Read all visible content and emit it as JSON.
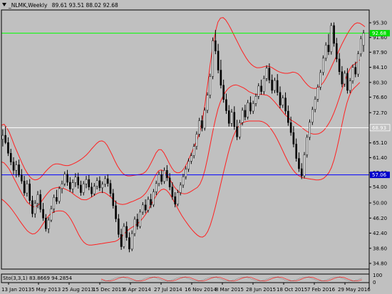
{
  "header": {
    "symbol": "_NLMK,Weekly",
    "ohlc": "89.61 93.51 88.02 92.68"
  },
  "indicator": {
    "label": "Sto(3,3,1) 83.8669 94.2854"
  },
  "colors": {
    "background": "#c0c0c0",
    "bull_body": "#ffffff",
    "bear_body": "#000000",
    "wick": "#000000",
    "bands": "#ff2020",
    "line_green": "#00ff00",
    "line_white": "#ffffff",
    "line_blue": "#0000ff",
    "price_tag_bg": "#00dd00",
    "blue_tag_bg": "#0000cc"
  },
  "chart_data": {
    "type": "candlestick",
    "y_axis_labels": [
      "95.30",
      "91.60",
      "87.90",
      "84.10",
      "80.30",
      "76.60",
      "72.70",
      "69.00",
      "65.10",
      "61.40",
      "57.60",
      "54.00",
      "50.00",
      "46.20",
      "42.40",
      "38.60",
      "34.80"
    ],
    "ylim": [
      34.8,
      95.3
    ],
    "x_axis_labels": [
      "13 Jan 2013",
      "5 May 2013",
      "25 Aug 2013",
      "15 Dec 2013",
      "6 Apr 2014",
      "27 Jul 2014",
      "16 Nov 2014",
      "8 Mar 2015",
      "28 Jun 2015",
      "18 Oct 2015",
      "7 Feb 2016",
      "29 May 2016"
    ],
    "price_tags": [
      {
        "label": "92.68",
        "value": 92.68,
        "role": "current"
      },
      {
        "label": "68.93",
        "value": 68.93,
        "role": "white-line"
      },
      {
        "label": "57.06",
        "value": 57.06,
        "role": "blue-line"
      }
    ],
    "horizontal_lines": [
      {
        "value": 92.68,
        "color": "#00ff00"
      },
      {
        "value": 68.93,
        "color": "#ffffff"
      },
      {
        "value": 57.06,
        "color": "#0000ff"
      }
    ],
    "bands": {
      "upper": [
        69.5,
        69.8,
        69.0,
        67.8,
        66.2,
        64.5,
        63.0,
        61.5,
        60.0,
        58.6,
        57.5,
        56.6,
        56.0,
        55.8,
        55.9,
        56.3,
        57.0,
        57.8,
        58.5,
        59.1,
        59.6,
        59.8,
        59.8,
        59.7,
        59.5,
        59.4,
        59.4,
        59.6,
        59.9,
        60.2,
        60.6,
        61.0,
        61.5,
        62.1,
        62.8,
        63.6,
        64.3,
        65.0,
        65.5,
        65.6,
        65.3,
        64.5,
        63.3,
        62.0,
        60.6,
        59.3,
        58.3,
        57.5,
        57.0,
        56.8,
        56.8,
        56.9,
        57.0,
        57.1,
        57.2,
        57.4,
        57.9,
        58.8,
        60.0,
        61.3,
        62.6,
        63.4,
        63.4,
        62.6,
        61.4,
        60.1,
        58.9,
        58.0,
        57.6,
        57.6,
        58.0,
        58.8,
        60.0,
        61.5,
        63.0,
        64.5,
        66.0,
        68.0,
        71.0,
        75.0,
        80.0,
        85.0,
        89.5,
        93.0,
        95.5,
        96.5,
        96.6,
        96.0,
        95.0,
        93.8,
        92.5,
        91.2,
        89.9,
        88.6,
        87.5,
        86.4,
        85.5,
        84.8,
        84.3,
        84.0,
        84.0,
        84.1,
        84.3,
        84.4,
        84.3,
        84.0,
        83.6,
        83.2,
        82.9,
        82.7,
        82.6,
        82.6,
        82.7,
        82.9,
        82.8,
        82.5,
        81.9,
        81.0,
        80.2,
        79.5,
        79.0,
        78.8,
        78.8,
        79.1,
        79.6,
        80.4,
        81.5,
        82.8,
        84.2,
        85.6,
        87.0,
        88.4,
        89.8,
        91.1,
        92.3,
        93.4,
        94.3,
        95.0,
        95.3,
        95.2,
        94.8,
        94.3
      ],
      "lower": [
        51.0,
        50.5,
        49.9,
        49.2,
        48.4,
        47.5,
        46.6,
        45.6,
        44.7,
        43.8,
        43.0,
        42.5,
        42.2,
        42.3,
        42.8,
        43.6,
        44.6,
        45.6,
        46.5,
        47.2,
        47.6,
        47.9,
        48.0,
        48.0,
        47.9,
        47.5,
        46.8,
        45.8,
        44.6,
        43.3,
        42.0,
        40.9,
        40.1,
        39.6,
        39.4,
        39.4,
        39.5,
        39.6,
        39.7,
        39.8,
        39.9,
        40.0,
        40.1,
        40.2,
        40.3,
        40.6,
        41.1,
        41.8,
        42.5,
        43.1,
        43.6,
        44.0,
        44.4,
        44.9,
        45.5,
        46.3,
        47.2,
        48.3,
        49.5,
        50.7,
        51.8,
        52.7,
        53.3,
        53.5,
        53.2,
        52.5,
        51.5,
        50.3,
        49.1,
        47.9,
        46.8,
        45.8,
        44.9,
        44.0,
        43.2,
        42.5,
        41.9,
        41.5,
        41.4,
        41.8,
        42.8,
        44.4,
        46.5,
        49.0,
        51.7,
        54.5,
        57.3,
        60.0,
        62.6,
        64.9,
        66.8,
        68.2,
        69.2,
        69.9,
        70.3,
        70.5,
        70.6,
        70.6,
        70.6,
        70.6,
        70.6,
        70.5,
        70.2,
        69.8,
        69.1,
        68.2,
        67.2,
        66.0,
        64.7,
        63.3,
        61.9,
        60.6,
        59.4,
        58.4,
        57.6,
        57.0,
        56.6,
        56.3,
        56.2,
        56.1,
        56.0,
        55.9,
        55.8,
        55.8,
        55.9,
        56.2,
        56.8,
        57.6,
        58.9,
        60.8,
        63.3,
        66.2,
        69.4,
        72.5,
        75.1,
        77.0,
        78.3,
        79.0,
        79.6,
        80.3
      ],
      "middle": [
        60.3,
        60.1,
        59.4,
        58.5,
        57.3,
        56.0,
        54.8,
        53.5,
        52.3,
        51.2,
        50.2,
        49.6,
        49.1,
        49.0,
        49.3,
        49.9,
        50.8,
        51.7,
        52.5,
        53.2,
        53.6,
        53.8,
        53.9,
        53.8,
        53.7,
        53.4,
        53.1,
        52.7,
        52.2,
        51.7,
        51.3,
        50.9,
        50.8,
        50.8,
        51.1,
        51.5,
        51.9,
        52.3,
        52.6,
        52.7,
        52.6,
        52.2,
        51.7,
        51.1,
        50.4,
        49.9,
        49.7,
        49.6,
        49.7,
        49.9,
        50.2,
        50.4,
        50.7,
        51.0,
        51.3,
        51.8,
        52.5,
        53.5,
        54.7,
        56.0,
        57.2,
        58.1,
        58.3,
        58.0,
        57.3,
        56.3,
        55.2,
        54.1,
        53.3,
        52.7,
        52.4,
        52.3,
        52.4,
        52.7,
        53.1,
        53.5,
        53.9,
        54.7,
        56.2,
        58.4,
        61.4,
        64.7,
        68.0,
        71.0,
        73.6,
        75.5,
        76.9,
        78.0,
        78.8,
        79.3,
        79.6,
        79.7,
        79.5,
        79.2,
        78.9,
        78.5,
        78.0,
        77.7,
        77.4,
        77.3,
        77.3,
        77.3,
        77.2,
        77.1,
        76.7,
        76.1,
        75.4,
        74.6,
        73.8,
        73.0,
        72.2,
        71.6,
        71.0,
        70.6,
        70.2,
        69.7,
        69.3,
        68.7,
        68.2,
        67.8,
        67.5,
        67.3,
        67.3,
        67.4,
        67.7,
        68.2,
        69.0,
        70.0,
        71.2,
        72.7,
        74.4,
        76.3,
        78.3,
        80.3,
        82.1,
        83.5,
        84.5,
        84.9,
        85.4,
        86.0
      ],
      "period_offset": 0
    },
    "candles": [
      [
        66.0,
        68.5,
        64.2,
        67.0
      ],
      [
        67.0,
        69.2,
        64.8,
        65.2
      ],
      [
        65.2,
        66.5,
        61.8,
        62.5
      ],
      [
        62.5,
        63.6,
        59.5,
        60.3
      ],
      [
        60.3,
        61.5,
        57.2,
        58.2
      ],
      [
        58.2,
        60.6,
        56.4,
        59.6
      ],
      [
        59.6,
        60.9,
        56.5,
        57.0
      ],
      [
        57.0,
        58.5,
        54.8,
        55.5
      ],
      [
        55.5,
        56.8,
        51.8,
        52.5
      ],
      [
        52.5,
        55.7,
        51.6,
        54.8
      ],
      [
        54.8,
        56.0,
        49.8,
        50.6
      ],
      [
        50.6,
        51.8,
        46.4,
        47.3
      ],
      [
        47.3,
        50.7,
        46.3,
        49.9
      ],
      [
        49.9,
        53.0,
        48.7,
        52.1
      ],
      [
        52.1,
        53.3,
        47.6,
        48.4
      ],
      [
        48.4,
        50.0,
        45.5,
        46.2
      ],
      [
        46.2,
        47.2,
        42.8,
        43.5
      ],
      [
        43.5,
        46.4,
        42.4,
        45.7
      ],
      [
        45.7,
        49.3,
        45.2,
        48.5
      ],
      [
        48.5,
        52.1,
        47.5,
        51.4
      ],
      [
        51.4,
        53.3,
        49.7,
        50.4
      ],
      [
        50.4,
        54.2,
        49.8,
        53.6
      ],
      [
        53.6,
        55.6,
        52.4,
        54.8
      ],
      [
        54.8,
        57.9,
        54.2,
        57.2
      ],
      [
        57.2,
        58.3,
        54.3,
        55.2
      ],
      [
        55.2,
        56.5,
        52.8,
        53.5
      ],
      [
        53.5,
        55.9,
        52.5,
        55.1
      ],
      [
        55.1,
        57.5,
        54.0,
        56.5
      ],
      [
        56.5,
        57.6,
        53.6,
        54.5
      ],
      [
        54.5,
        55.6,
        51.8,
        52.6
      ],
      [
        52.6,
        55.5,
        51.9,
        54.8
      ],
      [
        54.8,
        56.8,
        53.7,
        55.9
      ],
      [
        55.9,
        57.0,
        53.2,
        54.0
      ],
      [
        54.0,
        55.1,
        51.5,
        52.3
      ],
      [
        52.3,
        55.0,
        51.8,
        54.2
      ],
      [
        54.2,
        56.4,
        53.4,
        55.6
      ],
      [
        55.6,
        56.7,
        53.0,
        53.8
      ],
      [
        53.8,
        55.4,
        52.5,
        54.7
      ],
      [
        54.7,
        56.8,
        54.0,
        56.1
      ],
      [
        56.1,
        57.2,
        54.1,
        54.9
      ],
      [
        54.9,
        55.8,
        51.6,
        52.4
      ],
      [
        52.4,
        53.5,
        48.6,
        49.3
      ],
      [
        49.3,
        50.6,
        45.2,
        46.0
      ],
      [
        46.0,
        47.2,
        41.3,
        42.1
      ],
      [
        42.1,
        43.5,
        38.2,
        39.0
      ],
      [
        39.0,
        44.9,
        38.5,
        44.1
      ],
      [
        44.1,
        45.3,
        40.5,
        41.3
      ],
      [
        41.3,
        42.6,
        37.6,
        38.4
      ],
      [
        38.4,
        43.1,
        37.9,
        42.3
      ],
      [
        42.3,
        46.6,
        41.6,
        45.9
      ],
      [
        45.9,
        47.3,
        43.3,
        44.1
      ],
      [
        44.1,
        48.4,
        43.6,
        47.7
      ],
      [
        47.7,
        50.2,
        47.0,
        49.5
      ],
      [
        49.5,
        50.9,
        47.4,
        48.2
      ],
      [
        48.2,
        51.6,
        47.6,
        50.9
      ],
      [
        50.9,
        52.3,
        48.7,
        49.5
      ],
      [
        49.5,
        53.5,
        49.0,
        52.8
      ],
      [
        52.8,
        55.6,
        52.0,
        54.9
      ],
      [
        54.9,
        57.9,
        54.2,
        57.1
      ],
      [
        57.1,
        58.2,
        54.6,
        55.4
      ],
      [
        55.4,
        58.9,
        54.8,
        58.2
      ],
      [
        58.2,
        59.5,
        55.5,
        56.3
      ],
      [
        56.3,
        57.5,
        53.2,
        54.0
      ],
      [
        54.0,
        55.2,
        50.8,
        51.6
      ],
      [
        51.6,
        52.7,
        48.9,
        49.7
      ],
      [
        49.7,
        53.3,
        49.2,
        52.6
      ],
      [
        52.6,
        55.2,
        51.9,
        54.5
      ],
      [
        54.5,
        57.3,
        53.8,
        56.6
      ],
      [
        56.6,
        59.2,
        55.9,
        58.5
      ],
      [
        58.5,
        61.2,
        57.8,
        60.5
      ],
      [
        60.5,
        62.6,
        59.8,
        61.9
      ],
      [
        61.9,
        64.9,
        61.2,
        64.2
      ],
      [
        64.2,
        68.0,
        63.4,
        67.3
      ],
      [
        67.3,
        71.4,
        66.6,
        70.7
      ],
      [
        70.7,
        72.0,
        68.0,
        68.8
      ],
      [
        68.8,
        74.0,
        68.2,
        73.3
      ],
      [
        73.3,
        77.8,
        72.6,
        77.1
      ],
      [
        77.1,
        82.5,
        76.3,
        81.8
      ],
      [
        81.8,
        91.6,
        81.1,
        90.8
      ],
      [
        90.8,
        93.5,
        87.4,
        88.2
      ],
      [
        88.2,
        90.0,
        82.6,
        83.4
      ],
      [
        83.4,
        86.0,
        78.8,
        79.6
      ],
      [
        79.6,
        81.0,
        75.2,
        76.0
      ],
      [
        76.0,
        77.5,
        72.4,
        73.2
      ],
      [
        73.2,
        74.6,
        69.2,
        70.0
      ],
      [
        70.0,
        73.6,
        69.2,
        72.8
      ],
      [
        72.8,
        74.3,
        68.4,
        69.2
      ],
      [
        69.2,
        70.9,
        65.8,
        66.6
      ],
      [
        66.6,
        70.9,
        66.0,
        70.2
      ],
      [
        70.2,
        74.0,
        69.5,
        73.3
      ],
      [
        73.3,
        74.7,
        70.8,
        71.6
      ],
      [
        71.6,
        75.9,
        71.0,
        75.2
      ],
      [
        75.2,
        76.8,
        72.3,
        73.1
      ],
      [
        73.1,
        75.7,
        72.4,
        75.0
      ],
      [
        75.0,
        77.5,
        74.3,
        76.8
      ],
      [
        76.8,
        80.1,
        76.1,
        79.4
      ],
      [
        79.4,
        81.0,
        77.2,
        78.0
      ],
      [
        78.0,
        82.0,
        77.3,
        81.3
      ],
      [
        81.3,
        84.6,
        80.6,
        83.9
      ],
      [
        83.9,
        85.1,
        80.1,
        80.9
      ],
      [
        80.9,
        82.3,
        77.5,
        78.3
      ],
      [
        78.3,
        81.5,
        77.6,
        80.8
      ],
      [
        80.8,
        82.4,
        77.0,
        77.8
      ],
      [
        77.8,
        79.3,
        73.8,
        74.6
      ],
      [
        74.6,
        77.1,
        73.9,
        76.4
      ],
      [
        76.4,
        77.8,
        72.3,
        73.1
      ],
      [
        73.1,
        74.5,
        69.4,
        70.2
      ],
      [
        70.2,
        71.7,
        66.9,
        67.7
      ],
      [
        67.7,
        69.3,
        64.0,
        64.8
      ],
      [
        64.8,
        66.2,
        60.4,
        61.2
      ],
      [
        61.2,
        62.7,
        57.8,
        58.6
      ],
      [
        58.6,
        60.0,
        56.0,
        56.8
      ],
      [
        56.8,
        62.8,
        56.2,
        62.1
      ],
      [
        62.1,
        67.2,
        61.4,
        66.5
      ],
      [
        66.5,
        71.0,
        65.8,
        70.3
      ],
      [
        70.3,
        74.2,
        69.6,
        73.5
      ],
      [
        73.5,
        76.8,
        72.8,
        76.1
      ],
      [
        76.1,
        79.8,
        75.4,
        79.1
      ],
      [
        79.1,
        83.5,
        78.4,
        82.8
      ],
      [
        82.8,
        87.1,
        82.1,
        86.4
      ],
      [
        86.4,
        90.4,
        85.7,
        89.7
      ],
      [
        89.7,
        92.5,
        87.2,
        88.0
      ],
      [
        88.0,
        95.3,
        87.3,
        94.6
      ],
      [
        94.6,
        95.4,
        89.3,
        90.1
      ],
      [
        90.1,
        91.5,
        85.4,
        86.2
      ],
      [
        86.2,
        87.7,
        82.2,
        83.0
      ],
      [
        83.0,
        84.4,
        79.1,
        79.9
      ],
      [
        79.9,
        83.3,
        79.2,
        82.6
      ],
      [
        82.6,
        83.9,
        77.5,
        78.3
      ],
      [
        78.3,
        81.4,
        77.6,
        80.7
      ],
      [
        80.7,
        84.8,
        80.0,
        84.1
      ],
      [
        84.1,
        85.5,
        81.6,
        82.4
      ],
      [
        82.4,
        88.2,
        81.7,
        87.5
      ],
      [
        87.5,
        92.0,
        86.8,
        91.3
      ],
      [
        89.6,
        93.5,
        88.0,
        92.7
      ]
    ]
  }
}
